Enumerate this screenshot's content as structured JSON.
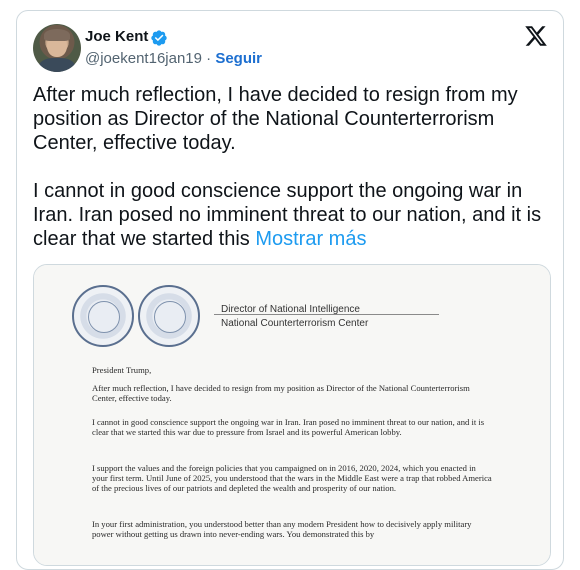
{
  "author": {
    "name": "Joe Kent",
    "handle": "@joekent16jan19",
    "separator": "·",
    "follow_label": "Seguir"
  },
  "tweet": {
    "text": "After much reflection, I have decided to resign from my position as Director of the National Counterterrorism Center, effective today.\n\nI cannot in good conscience support the ongoing war in Iran. Iran posed no imminent threat to our nation, and it is clear that we started this ",
    "show_more_label": "Mostrar más"
  },
  "letter": {
    "header_line1": "Director of National Intelligence",
    "header_line2": "National Counterterrorism Center",
    "salutation": "President Trump,",
    "p1": "After much reflection, I have decided to resign from my position as Director of the National Counterterrorism Center, effective today.",
    "p2": "I cannot in good conscience support the ongoing war in Iran. Iran posed no imminent threat to our nation, and it is clear that we started this war due to pressure from Israel and its powerful American lobby.",
    "p3": "I support the values and the foreign policies that you campaigned on in 2016, 2020, 2024, which you enacted in your first term. Until June of 2025, you understood that the wars in the Middle East were a trap that robbed America of the precious lives of our patriots and depleted the wealth and prosperity of our nation.",
    "p4": "In your first administration, you understood better than any modern President how to decisively apply military power without getting us drawn into never-ending wars. You demonstrated this by"
  },
  "icons": {
    "verified": "verified-badge-icon",
    "platform": "x-logo-icon"
  },
  "colors": {
    "link": "#1d9bf0",
    "follow": "#1d6fd0",
    "verified": "#1d9bf0",
    "border": "#cfd9de"
  }
}
